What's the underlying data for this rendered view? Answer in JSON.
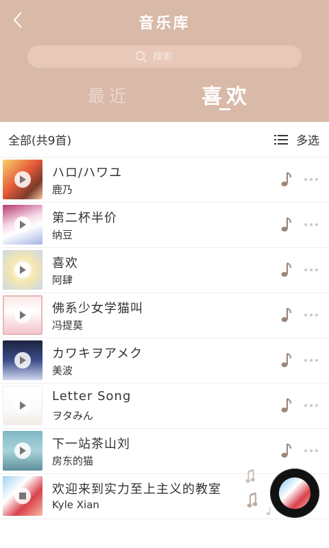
{
  "header": {
    "title": "音乐库",
    "search_placeholder": "搜索",
    "tabs": [
      {
        "label": "最近",
        "active": false
      },
      {
        "label": "喜欢",
        "active": true
      }
    ],
    "bg_color": "#d9b9a8"
  },
  "list": {
    "count_label": "全部(共9首)",
    "multi_select_label": "多选",
    "songs": [
      {
        "title": "ハロ/ハワユ",
        "artist": "鹿乃"
      },
      {
        "title": "第二杯半价",
        "artist": "纳豆"
      },
      {
        "title": "喜欢",
        "artist": "阿肆"
      },
      {
        "title": "佛系少女学猫叫",
        "artist": "冯提莫"
      },
      {
        "title": "カワキヲアメク",
        "artist": "美波"
      },
      {
        "title": "Letter Song",
        "artist": "ヲタみん"
      },
      {
        "title": "下一站茶山刘",
        "artist": "房东的猫"
      },
      {
        "title": "欢迎来到实力至上主义的教室",
        "artist": "Kyle Xian"
      }
    ]
  },
  "icons": {
    "back": "chevron-left-icon",
    "search": "search-icon",
    "list": "list-icon",
    "note": "music-note-icon",
    "more": "more-dots-icon",
    "vinyl": "vinyl-record-icon"
  },
  "colors": {
    "accent_brown": "#a38a7a",
    "note_color": "#9c8677"
  }
}
